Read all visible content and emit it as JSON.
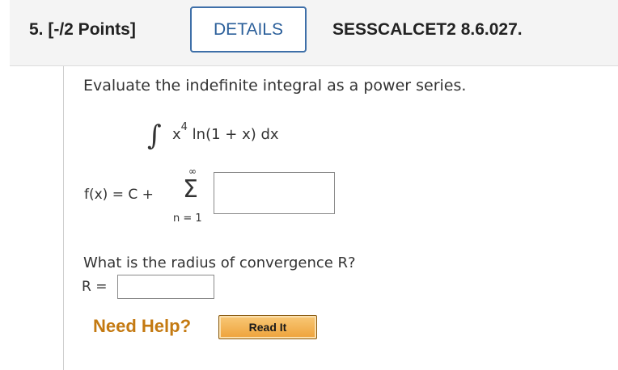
{
  "header": {
    "question_label": "5. [-/2 Points]",
    "details_button": "DETAILS",
    "reference_id": "SESSCALCET2 8.6.027."
  },
  "problem": {
    "prompt": "Evaluate the indefinite integral as a power series.",
    "integral_sign": "∫",
    "integrand_base": "x",
    "integrand_exponent": "4",
    "integrand_rest": "ln(1 + x) dx",
    "fx_lhs": "f(x) = C +",
    "sum_upper": "∞",
    "sum_symbol": "Σ",
    "sum_lower": "n = 1",
    "series_input_value": "",
    "radius_question": "What is the radius of convergence R?",
    "radius_label": "R =",
    "radius_input_value": ""
  },
  "help": {
    "need_help": "Need Help?",
    "read_it_button": "Read It"
  },
  "colors": {
    "details_border": "#3e6fa8",
    "need_help_text": "#c47a12",
    "read_it_bg": "#eea23a"
  }
}
